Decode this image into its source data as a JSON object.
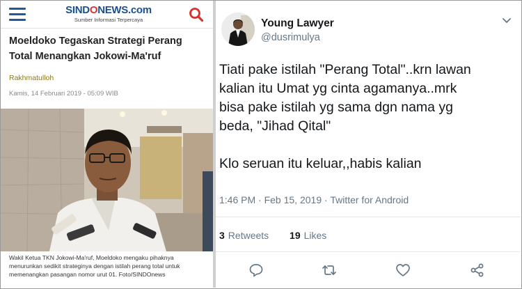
{
  "news": {
    "logo": {
      "part1": "SIND",
      "part2": "O",
      "part3": "NEWS.com",
      "tagline": "Sumber Informasi Terpercaya"
    },
    "headline": "Moeldoko Tegaskan Strategi Perang Total Menangkan Jokowi-Ma'ruf",
    "author": "Rakhmatulloh",
    "date": "Kamis, 14 Februari 2019 - 05:09 WIB",
    "caption": "Wakil Ketua TKN Jokowi-Ma'ruf, Moeldoko mengaku pihaknya menurunkan sedikit strateginya dengan istilah perang total untuk memenangkan pasangan nomor urut 01. Foto/SINDOnews",
    "icons": {
      "menu": "hamburger-menu-icon",
      "search": "search-icon"
    },
    "colors": {
      "brand_blue": "#1b4f94",
      "brand_red": "#e0322b",
      "menu_blue": "#1f5a9c",
      "search_red": "#d9302b",
      "author": "#8a7a1c"
    }
  },
  "tweet": {
    "display_name": "Young Lawyer",
    "handle": "@dusrimulya",
    "text_lines": [
      "Tiati pake istilah \"Perang Total\"..krn lawan",
      "kalian itu Umat yg cinta agamanya..mrk",
      "bisa pake istilah yg sama dgn nama yg",
      "beda, \"Jihad Qital\"",
      "Klo seruan itu keluar,,habis kalian"
    ],
    "time": "1:46 PM",
    "date": "Feb 15, 2019",
    "source": "Twitter for Android",
    "meta_separator": " · ",
    "retweets_count": "3",
    "retweets_label": "Retweets",
    "likes_count": "19",
    "likes_label": "Likes",
    "icons": {
      "menu": "chevron-down-icon",
      "reply": "reply-icon",
      "retweet": "retweet-icon",
      "like": "heart-icon",
      "share": "share-icon"
    },
    "colors": {
      "text": "#14171a",
      "secondary": "#657786",
      "divider": "#e1e8ed"
    }
  }
}
